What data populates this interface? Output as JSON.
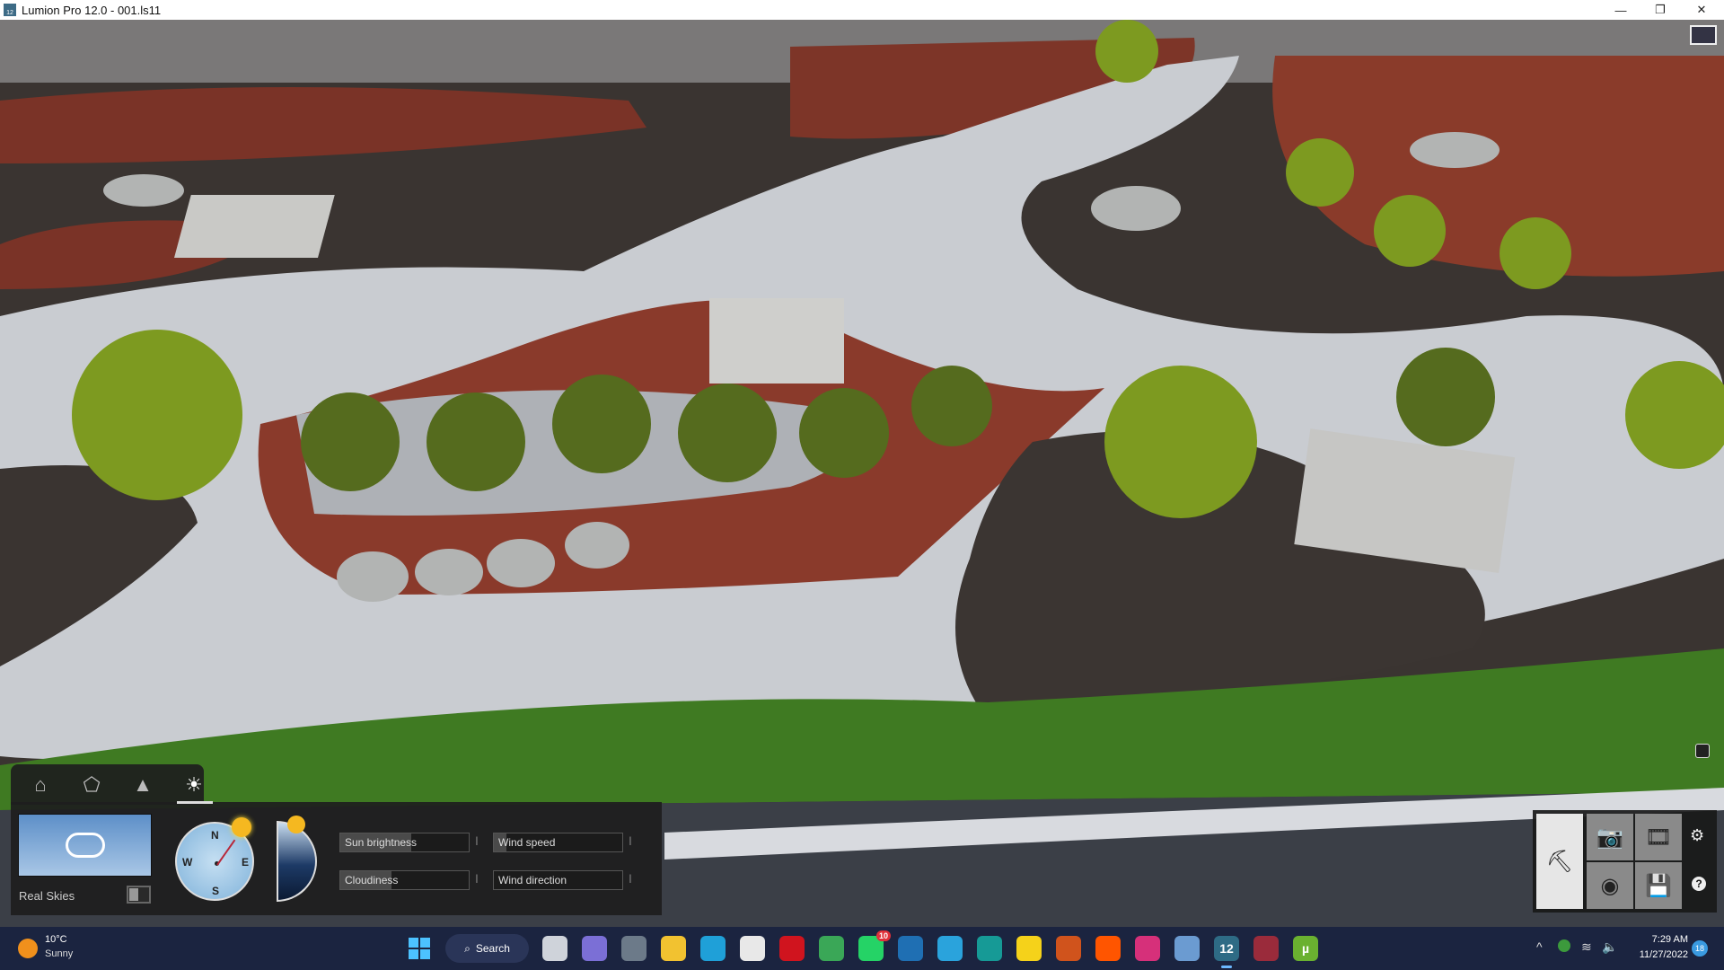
{
  "window": {
    "title": "Lumion Pro 12.0  - 001.ls11",
    "minimize": "—",
    "maximize": "❐",
    "close": "✕",
    "app_badge": "12"
  },
  "bottom_panel": {
    "tabs": [
      {
        "name": "home",
        "icon": "⌂"
      },
      {
        "name": "materials",
        "icon": "⬠"
      },
      {
        "name": "landscape",
        "icon": "▲"
      },
      {
        "name": "weather",
        "icon": "☀"
      }
    ],
    "active_tab": "weather",
    "real_skies_label": "Real Skies",
    "real_skies_enabled": false,
    "compass": {
      "N": "N",
      "E": "E",
      "S": "S",
      "W": "W"
    },
    "sliders": [
      {
        "label": "Sun brightness",
        "value": 0.55
      },
      {
        "label": "Cloudiness",
        "value": 0.4
      },
      {
        "label": "Wind speed",
        "value": 0.1
      },
      {
        "label": "Wind direction",
        "value": 0.0
      }
    ]
  },
  "mode_panel": {
    "gear": "⚙",
    "help": "?"
  },
  "taskbar": {
    "weather": {
      "temp": "10°C",
      "condition": "Sunny"
    },
    "search_label": "Search",
    "apps": [
      {
        "name": "task-view",
        "color": "#cfd3da"
      },
      {
        "name": "teams",
        "color": "#7b6fd6"
      },
      {
        "name": "calculator",
        "color": "#6c7a89"
      },
      {
        "name": "file-explorer",
        "color": "#f2c230"
      },
      {
        "name": "edge",
        "color": "#1fa0d8"
      },
      {
        "name": "store",
        "color": "#e8e8e8"
      },
      {
        "name": "opera",
        "color": "#d0141e"
      },
      {
        "name": "chrome",
        "color": "#3aa757"
      },
      {
        "name": "whatsapp",
        "color": "#25d366",
        "badge": "10"
      },
      {
        "name": "sketchup",
        "color": "#1f6fb3"
      },
      {
        "name": "telegram",
        "color": "#2aa3dc"
      },
      {
        "name": "3ds-max",
        "color": "#169a96"
      },
      {
        "name": "sticky-notes",
        "color": "#f5d21a"
      },
      {
        "name": "gpu-tweak",
        "color": "#d0531c"
      },
      {
        "name": "soundcloud",
        "color": "#ff5500"
      },
      {
        "name": "instagram",
        "color": "#d6307a"
      },
      {
        "name": "monitor",
        "color": "#6b9bd1"
      },
      {
        "name": "lumion",
        "color": "#2e6b85",
        "label": "12"
      },
      {
        "name": "winrar",
        "color": "#9a2b3b"
      },
      {
        "name": "utorrent",
        "color": "#6ab130",
        "label": "µ"
      }
    ],
    "time": "7:29 AM",
    "date": "11/27/2022",
    "notification_count": "18"
  }
}
